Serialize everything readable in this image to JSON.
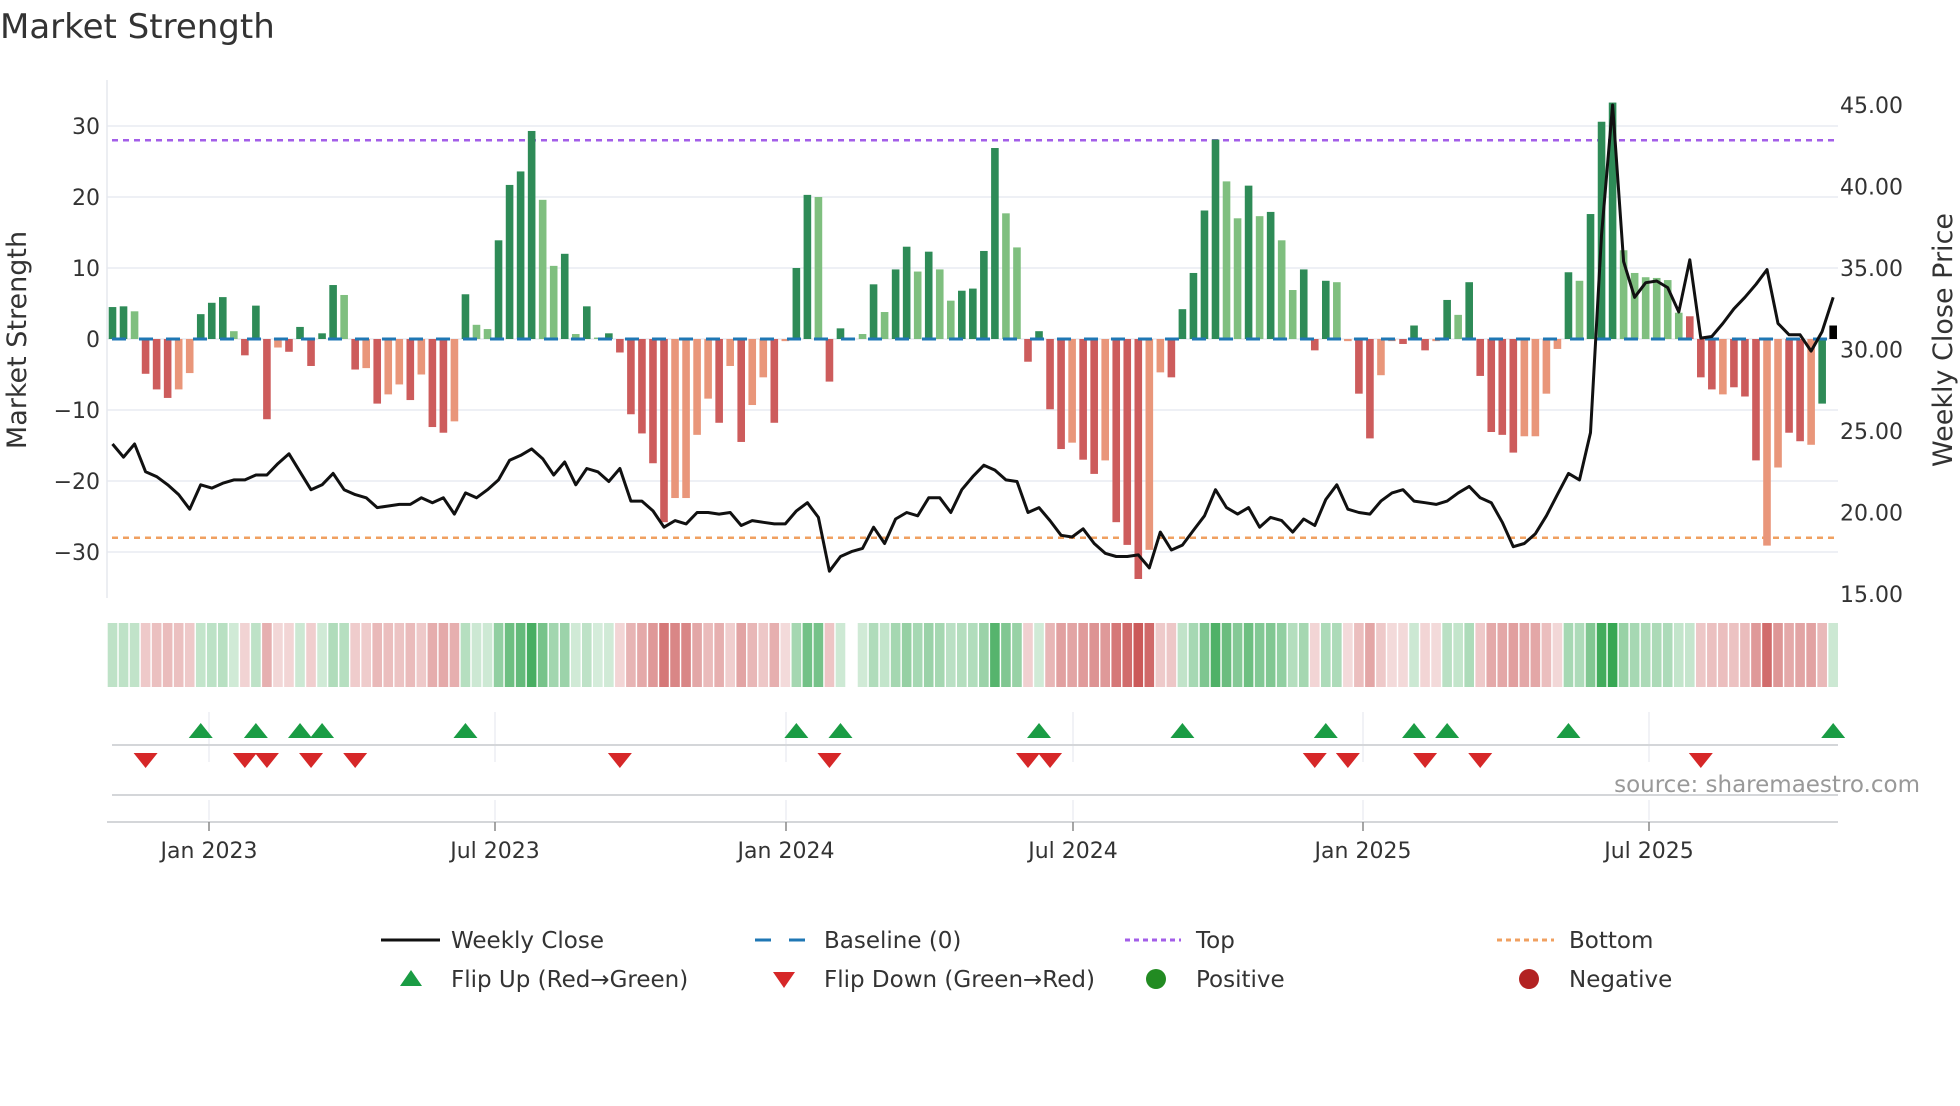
{
  "title": "Market Strength",
  "source": "source: sharemaestro.com",
  "colors": {
    "bar_dark_green": "#2e8b57",
    "bar_light_green": "#7fbf7f",
    "bar_red": "#cd5c5c",
    "bar_salmon": "#e9967a",
    "price_line": "#111111",
    "baseline": "#1f77b4",
    "top": "#a35ee8",
    "bottom": "#f0a060",
    "flip_up": "#1a9c44",
    "flip_down": "#d62728",
    "positive": "#228b22",
    "negative": "#b22222"
  },
  "chart_data": {
    "type": "bar",
    "title": "Market Strength",
    "ylabel": "Market Strength",
    "y2label": "Weekly Close Price",
    "ylim": [
      -36,
      36
    ],
    "y2lim": [
      15,
      47
    ],
    "yticks": [
      "30",
      "20",
      "10",
      "0",
      "−10",
      "−20",
      "−30"
    ],
    "y2ticks": [
      "45.00",
      "40.00",
      "35.00",
      "30.00",
      "25.00",
      "20.00",
      "15.00"
    ],
    "xticks": [
      "Jan 2023",
      "Jul 2023",
      "Jan 2024",
      "Jul 2024",
      "Jan 2025",
      "Jul 2025"
    ],
    "grid": true,
    "legend_position": "bottom",
    "top_level": 28,
    "bottom_level": -28,
    "baseline": 0,
    "tone_key": {
      "G": "dark green",
      "g": "light green",
      "R": "red",
      "r": "salmon"
    },
    "strength": [
      4.5,
      4.6,
      3.9,
      -4.9,
      -7.1,
      -8.3,
      -7.1,
      -4.8,
      3.5,
      5.1,
      5.9,
      1.1,
      -2.3,
      4.7,
      -11.3,
      -1.2,
      -1.8,
      1.7,
      -3.8,
      0.8,
      7.6,
      6.2,
      -4.3,
      -4.1,
      -9.1,
      -7.8,
      -6.4,
      -8.6,
      -5.0,
      -12.4,
      -13.2,
      -11.6,
      6.3,
      2.0,
      1.4,
      13.9,
      21.7,
      23.6,
      29.3,
      19.6,
      10.3,
      12.0,
      0.7,
      4.6,
      0.2,
      0.8,
      -1.9,
      -10.6,
      -13.3,
      -17.5,
      -25.8,
      -22.4,
      -22.4,
      -13.5,
      -8.4,
      -11.8,
      -3.8,
      -14.5,
      -9.3,
      -5.4,
      -11.8,
      -0.3,
      10.0,
      20.3,
      20.0,
      -6.0,
      1.5,
      0,
      0.7,
      7.7,
      3.8,
      9.8,
      13.0,
      9.5,
      12.3,
      9.8,
      5.4,
      6.8,
      7.1,
      12.4,
      26.9,
      17.7,
      12.9,
      -3.2,
      1.1,
      -9.9,
      -15.5,
      -14.6,
      -17.0,
      -19.0,
      -17.1,
      -25.8,
      -29.0,
      -33.8,
      -29.7,
      -4.7,
      -5.4,
      4.2,
      9.3,
      18.1,
      28.1,
      22.2,
      17.0,
      21.6,
      17.3,
      17.9,
      13.9,
      6.9,
      9.8,
      -1.6,
      8.2,
      8.0,
      -0.3,
      -7.7,
      -14.0,
      -5.1,
      -0.3,
      -0.7,
      1.9,
      -1.6,
      -0.3,
      5.5,
      3.4,
      8.0,
      -5.2,
      -13.1,
      -13.5,
      -16.0,
      -13.7,
      -13.7,
      -7.7,
      -1.4,
      9.4,
      8.2,
      17.6,
      30.6,
      33.3,
      12.5,
      9.3,
      8.7,
      8.6,
      8.3,
      3.7,
      3.2,
      -5.4,
      -7.1,
      -7.8,
      -6.8,
      -8.1,
      -17.1,
      -29.1,
      -18.1,
      -13.2,
      -14.4,
      -14.9,
      -9.1,
      1.9
    ],
    "tones": "GGgRRRrrGGGgRGRrRGRGGgRrRrrRrRRrGggGGGGggGgGgGRRRRRrrrrRrRrrRrGGgRGggGgGGgGggGGGGggRGRRrRRrRRRrrRGGGGggGgGggGRGgrRRrrRGRrGgGRRRRrrrrGgGGGggggggRRRrRRRrrRRrG",
    "weekly_close": [
      24.2,
      23.4,
      24.2,
      22.5,
      22.2,
      21.7,
      21.1,
      20.2,
      21.7,
      21.5,
      21.8,
      22.0,
      22.0,
      22.3,
      22.3,
      23.0,
      23.6,
      22.5,
      21.4,
      21.7,
      22.4,
      21.4,
      21.1,
      20.9,
      20.3,
      20.4,
      20.5,
      20.5,
      20.9,
      20.6,
      20.9,
      19.9,
      21.2,
      20.9,
      21.4,
      22.0,
      23.2,
      23.5,
      23.9,
      23.3,
      22.3,
      23.1,
      21.7,
      22.7,
      22.5,
      21.9,
      22.7,
      20.7,
      20.7,
      20.1,
      19.1,
      19.5,
      19.3,
      20.0,
      20.0,
      19.9,
      20.0,
      19.2,
      19.5,
      19.4,
      19.3,
      19.3,
      20.1,
      20.6,
      19.7,
      16.4,
      17.3,
      17.6,
      17.8,
      19.1,
      18.1,
      19.6,
      20.0,
      19.8,
      20.9,
      20.9,
      20.0,
      21.4,
      22.2,
      22.9,
      22.6,
      22.0,
      21.9,
      20.0,
      20.3,
      19.5,
      18.6,
      18.5,
      19.0,
      18.1,
      17.5,
      17.3,
      17.3,
      17.4,
      16.6,
      18.8,
      17.7,
      18.0,
      18.9,
      19.8,
      21.4,
      20.3,
      19.9,
      20.3,
      19.1,
      19.7,
      19.5,
      18.8,
      19.6,
      19.2,
      20.8,
      21.7,
      20.2,
      20.0,
      19.9,
      20.7,
      21.2,
      21.4,
      20.7,
      20.6,
      20.5,
      20.7,
      21.2,
      21.6,
      20.9,
      20.6,
      19.4,
      17.9,
      18.1,
      18.7,
      19.8,
      21.1,
      22.4,
      22.0,
      24.9,
      37.0,
      45.0,
      35.4,
      33.2,
      34.1,
      34.2,
      33.8,
      32.3,
      35.5,
      30.7,
      30.8,
      31.6,
      32.5,
      33.2,
      34.0,
      34.9,
      31.6,
      30.9,
      30.9,
      29.9,
      31.1,
      33.2
    ],
    "flip_up_weeks": [
      9,
      14,
      18,
      20,
      33,
      63,
      67,
      85,
      98,
      111,
      119,
      122,
      133,
      157
    ],
    "flip_down_weeks": [
      4,
      13,
      15,
      19,
      23,
      47,
      66,
      84,
      86,
      110,
      113,
      120,
      125,
      145
    ]
  },
  "legend": {
    "weekly_close": "Weekly Close",
    "baseline": "Baseline (0)",
    "top": "Top",
    "bottom": "Bottom",
    "flip_up": "Flip Up (Red→Green)",
    "flip_down": "Flip Down (Green→Red)",
    "positive": "Positive",
    "negative": "Negative"
  }
}
